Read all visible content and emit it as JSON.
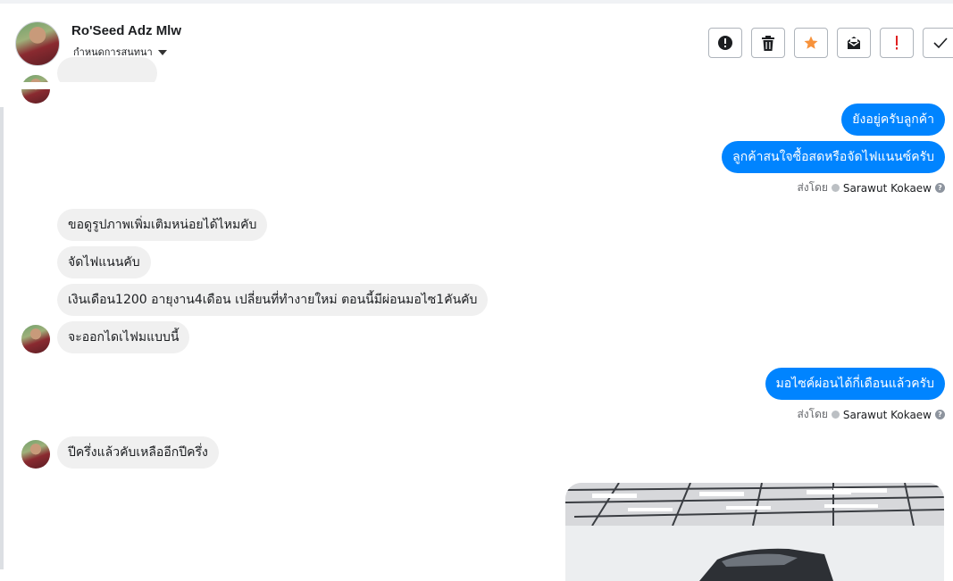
{
  "header": {
    "contact_name": "Ro'Seed Adz Mlw",
    "subtitle": "กำหนดการสนทนา"
  },
  "toolbar": {
    "buttons": [
      {
        "icon": "alert-circle-icon"
      },
      {
        "icon": "trash-icon"
      },
      {
        "icon": "star-icon",
        "color": "#f7923b"
      },
      {
        "icon": "mail-archive-icon"
      },
      {
        "icon": "exclamation-icon",
        "color": "#e02020"
      },
      {
        "icon": "check-icon"
      }
    ]
  },
  "messages": [
    {
      "dir": "out",
      "text": "ยังอยู่ครับลูกค้า"
    },
    {
      "dir": "out",
      "text": "ลูกค้าสนใจซื้อสดหรือจัดไฟแนนซ์ครับ"
    },
    {
      "dir": "in",
      "text": "ขอดูรูปภาพเพิ่มเติมหน่อยได้ไหมคับ"
    },
    {
      "dir": "in",
      "text": "จัดไฟแนนคับ"
    },
    {
      "dir": "in",
      "text": "เงินเดือน1200 อายุงาน4เดือน เปลี่ยนที่ทำงายใหม่ ตอนนี้มีผ่อนมอไซ1คันคับ"
    },
    {
      "dir": "in",
      "text": "จะออกไดเไฟมแบบนี้"
    },
    {
      "dir": "out",
      "text": "มอไซค์ผ่อนได้กี่เดือนแล้วครับ"
    },
    {
      "dir": "in",
      "text": "ปีครึ่งแล้วคับเหลืออีกปีครึ่ง"
    }
  ],
  "sent_by": {
    "label": "ส่งโดย",
    "agent": "Sarawut Kokaew"
  },
  "colors": {
    "outgoing_bubble": "#0084ff",
    "incoming_bubble": "#f0f0f0"
  }
}
